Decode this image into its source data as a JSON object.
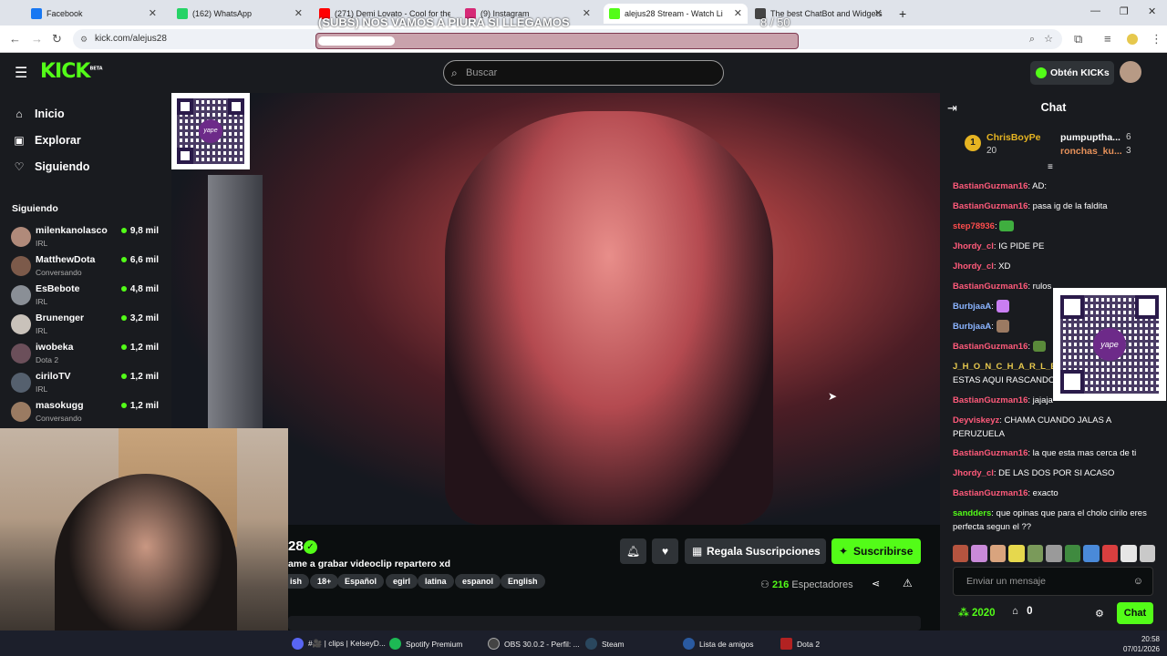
{
  "browser": {
    "tabs": [
      {
        "label": "Facebook",
        "color": "#1877f2"
      },
      {
        "label": "(162) WhatsApp",
        "color": "#25d366"
      },
      {
        "label": "(271) Demi Lovato - Cool for the",
        "color": "#ff0000"
      },
      {
        "label": "(9) Instagram",
        "color": "#d62976"
      },
      {
        "label": "alejus28 Stream - Watch Li",
        "color": "#53fc18"
      },
      {
        "label": "The best ChatBot and Widgets",
        "color": "#444444"
      }
    ],
    "url": "kick.com/alejus28",
    "new_tab": "+"
  },
  "goal": {
    "title": "(SUBS) NOS VAMOS A PIURA SI LLEGAMOS",
    "count": "8 / 50",
    "progress": 0.16
  },
  "header": {
    "logo": "KICK",
    "logo_sup": "BETA",
    "search_placeholder": "Buscar",
    "kicks_label": "Obtén KICKs"
  },
  "sidebar": {
    "nav": [
      {
        "label": "Inicio",
        "icon": "home-icon"
      },
      {
        "label": "Explorar",
        "icon": "compass-icon"
      },
      {
        "label": "Siguiendo",
        "icon": "heart-icon"
      }
    ],
    "section_title": "Siguiendo",
    "following": [
      {
        "name": "milenkanolasco",
        "category": "IRL",
        "viewers": "9,8 mil"
      },
      {
        "name": "MatthewDota",
        "category": "Conversando",
        "viewers": "6,6 mil"
      },
      {
        "name": "EsBebote",
        "category": "IRL",
        "viewers": "4,8 mil"
      },
      {
        "name": "Brunenger",
        "category": "IRL",
        "viewers": "3,2 mil"
      },
      {
        "name": "iwobeka",
        "category": "Dota 2",
        "viewers": "1,2 mil"
      },
      {
        "name": "ciriloTV",
        "category": "IRL",
        "viewers": "1,2 mil"
      },
      {
        "name": "masokugg",
        "category": "Conversando",
        "viewers": "1,2 mil"
      }
    ]
  },
  "stream": {
    "name_fragment": "28",
    "title_fragment": "ame a grabar videoclip repartero xd",
    "tags": [
      "ish",
      "18+",
      "Español",
      "egirl",
      "latina",
      "espanol",
      "English"
    ],
    "gift_label": "Regala Suscripciones",
    "subscribe_label": "Suscribirse",
    "viewers_count": "216",
    "viewers_label": "Espectadores"
  },
  "chat": {
    "title": "Chat",
    "pinned": [
      {
        "rank": "1",
        "name": "ChrisBoyPe",
        "value": "20"
      },
      {
        "name": "pumpuptha...",
        "value": "6"
      },
      {
        "name": "ronchas_ku...",
        "value": "3"
      }
    ],
    "messages": [
      {
        "user": "BastianGuzman16",
        "color": "#ff5a7a",
        "text": "AD:"
      },
      {
        "user": "BastianGuzman16",
        "color": "#ff5a7a",
        "text": "pasa ig de la faldita"
      },
      {
        "user": "step78936",
        "color": "#ff4d4d",
        "text": ""
      },
      {
        "user": "Jhordy_cl",
        "color": "#ff5a7a",
        "text": "IG PIDE PE"
      },
      {
        "user": "Jhordy_cl",
        "color": "#ff5a7a",
        "text": "XD"
      },
      {
        "user": "BastianGuzman16",
        "color": "#ff5a7a",
        "text": "rulos"
      },
      {
        "user": "BurbjaaA",
        "color": "#8ab4ff",
        "text": ""
      },
      {
        "user": "BurbjaaA",
        "color": "#8ab4ff",
        "text": ""
      },
      {
        "user": "BastianGuzman16",
        "color": "#ff5a7a",
        "text": ""
      },
      {
        "user": "J_H_O_N_C_H_A_R_L_E",
        "color": "#e6c84d",
        "text": "ESTAS AQUI RASCANDO"
      },
      {
        "user": "BastianGuzman16",
        "color": "#ff5a7a",
        "text": "jajaja"
      },
      {
        "user": "Deyviskeyz",
        "color": "#ff5a7a",
        "text": "CHAMA CUANDO JALAS A PERUZUELA"
      },
      {
        "user": "BastianGuzman16",
        "color": "#ff5a7a",
        "text": "la que esta mas cerca de ti"
      },
      {
        "user": "Jhordy_cl",
        "color": "#ff5a7a",
        "text": "DE LAS DOS POR SI ACASO"
      },
      {
        "user": "BastianGuzman16",
        "color": "#ff5a7a",
        "text": "exacto"
      },
      {
        "user": "sandders",
        "color": "#53fc18",
        "text": "que opinas que para el cholo cirilo eres perfecta segun el ??"
      }
    ],
    "input_placeholder": "Enviar un mensaje",
    "kicks_balance": "2020",
    "gift_count": "0",
    "send_label": "Chat"
  },
  "taskbar": {
    "items": [
      {
        "label": "#🎥 | clips | KelseyD...",
        "color": "#5865f2"
      },
      {
        "label": "Spotify Premium",
        "color": "#1db954"
      },
      {
        "label": "OBS 30.0.2 - Perfil: ...",
        "color": "#444"
      },
      {
        "label": "Steam",
        "color": "#1b2838"
      },
      {
        "label": "Lista de amigos",
        "color": "#2a5aa0"
      },
      {
        "label": "Dota 2",
        "color": "#b22222"
      }
    ],
    "time": "20:58",
    "date": "07/01/2026"
  }
}
